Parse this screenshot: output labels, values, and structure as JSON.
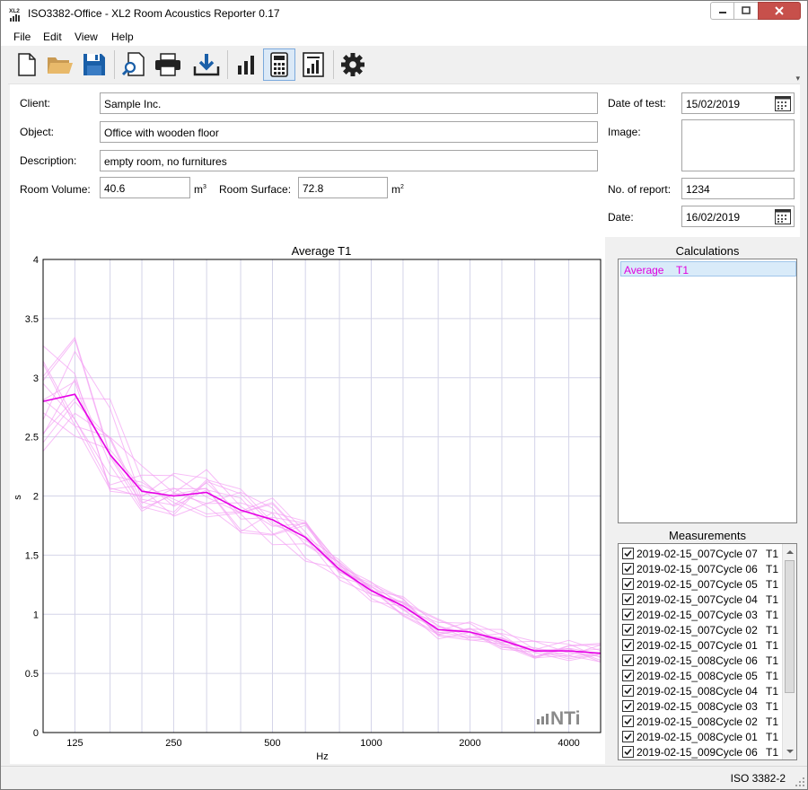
{
  "window": {
    "title": "ISO3382-Office - XL2 Room Acoustics Reporter 0.17",
    "app_icon_text": "XL2"
  },
  "menu": {
    "items": [
      "File",
      "Edit",
      "View",
      "Help"
    ]
  },
  "toolbar": {
    "buttons": [
      {
        "name": "new-file",
        "icon": "new-file-icon"
      },
      {
        "name": "open-folder",
        "icon": "folder-icon"
      },
      {
        "name": "save",
        "icon": "floppy-icon"
      },
      {
        "name": "print-preview",
        "icon": "print-preview-icon"
      },
      {
        "name": "print",
        "icon": "printer-icon"
      },
      {
        "name": "import",
        "icon": "download-tray-icon"
      },
      {
        "name": "chart-view",
        "icon": "bar-chart-icon"
      },
      {
        "name": "calculator",
        "icon": "calculator-icon",
        "active": true
      },
      {
        "name": "report",
        "icon": "report-icon"
      },
      {
        "name": "settings",
        "icon": "gear-icon"
      }
    ]
  },
  "form": {
    "client_label": "Client:",
    "client": "Sample Inc.",
    "object_label": "Object:",
    "object": "Office with wooden floor",
    "description_label": "Description:",
    "description": "empty room, no furnitures",
    "room_volume_label": "Room Volume:",
    "room_volume": "40.6",
    "room_volume_unit": "m",
    "room_surface_label": "Room Surface:",
    "room_surface": "72.8",
    "room_surface_unit": "m",
    "date_of_test_label": "Date of test:",
    "date_of_test": "15/02/2019",
    "image_label": "Image:",
    "report_no_label": "No. of report:",
    "report_no": "1234",
    "date_label": "Date:",
    "date": "16/02/2019"
  },
  "chart_data": {
    "type": "line",
    "title": "Average T1",
    "xlabel": "Hz",
    "ylabel": "s",
    "x_scale": "log",
    "x_tick_labels": [
      "125",
      "250",
      "500",
      "1000",
      "2000",
      "4000"
    ],
    "x": [
      100,
      125,
      160,
      200,
      250,
      315,
      400,
      500,
      630,
      800,
      1000,
      1250,
      1600,
      2000,
      2500,
      3150,
      4000,
      5000
    ],
    "ylim": [
      0,
      4
    ],
    "y_ticks": [
      "0",
      "0.5",
      "1",
      "1.5",
      "2",
      "2.5",
      "3",
      "3.5",
      "4"
    ],
    "grid": true,
    "series": [
      {
        "name": "Average T1",
        "color": "#e600e6",
        "values": [
          2.8,
          2.86,
          2.35,
          2.04,
          2.0,
          2.03,
          1.88,
          1.8,
          1.65,
          1.38,
          1.2,
          1.07,
          0.87,
          0.85,
          0.78,
          0.69,
          0.69,
          0.67
        ]
      }
    ],
    "individual_curve_color": "#f3a0f3",
    "watermark": "NTi"
  },
  "calculations": {
    "title": "Calculations",
    "rows": [
      {
        "name": "Average",
        "type": "T1"
      }
    ]
  },
  "measurements": {
    "title": "Measurements",
    "rows": [
      {
        "name": "2019-02-15_007Cycle 07",
        "type": "T1"
      },
      {
        "name": "2019-02-15_007Cycle 06",
        "type": "T1"
      },
      {
        "name": "2019-02-15_007Cycle 05",
        "type": "T1"
      },
      {
        "name": "2019-02-15_007Cycle 04",
        "type": "T1"
      },
      {
        "name": "2019-02-15_007Cycle 03",
        "type": "T1"
      },
      {
        "name": "2019-02-15_007Cycle 02",
        "type": "T1"
      },
      {
        "name": "2019-02-15_007Cycle 01",
        "type": "T1"
      },
      {
        "name": "2019-02-15_008Cycle 06",
        "type": "T1"
      },
      {
        "name": "2019-02-15_008Cycle 05",
        "type": "T1"
      },
      {
        "name": "2019-02-15_008Cycle 04",
        "type": "T1"
      },
      {
        "name": "2019-02-15_008Cycle 03",
        "type": "T1"
      },
      {
        "name": "2019-02-15_008Cycle 02",
        "type": "T1"
      },
      {
        "name": "2019-02-15_008Cycle 01",
        "type": "T1"
      },
      {
        "name": "2019-02-15_009Cycle 06",
        "type": "T1"
      }
    ]
  },
  "status": {
    "standard": "ISO 3382-2"
  }
}
